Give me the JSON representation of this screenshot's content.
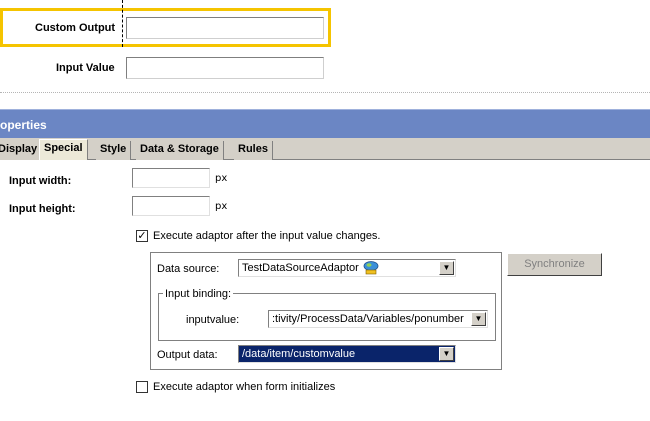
{
  "form": {
    "custom_output_label": "Custom Output",
    "custom_output_value": "",
    "input_value_label": "Input Value",
    "input_value_value": ""
  },
  "properties": {
    "title": "operties",
    "tabs": [
      {
        "label": "Display",
        "active": false
      },
      {
        "label": "Special",
        "active": true
      },
      {
        "label": "Style",
        "active": false
      },
      {
        "label": "Data & Storage",
        "active": false
      },
      {
        "label": "Rules",
        "active": false
      }
    ],
    "input_width_label": "Input width:",
    "input_width_value": "",
    "input_width_unit": "px",
    "input_height_label": "Input height:",
    "input_height_value": "",
    "input_height_unit": "px",
    "execute_on_change": {
      "label": "Execute adaptor after the input value changes.",
      "checked": true,
      "mark": "✓"
    },
    "data_source_label": "Data source:",
    "data_source_value": "TestDataSourceAdaptor",
    "input_binding_legend": "Input binding:",
    "inputvalue_label": "inputvalue:",
    "inputvalue_value": ":tivity/ProcessData/Variables/ponumber",
    "output_data_label": "Output data:",
    "output_data_value": "/data/item/customvalue",
    "synchronize_label": "Synchronize",
    "execute_on_init": {
      "label": "Execute adaptor when form initializes",
      "checked": false,
      "mark": ""
    },
    "dropdown_arrow": "▼"
  },
  "colors": {
    "selection_border": "#f5c400",
    "header_bg": "#6b86c4",
    "tab_bg": "#d4d0c8",
    "selected_option_bg": "#0a246a"
  }
}
